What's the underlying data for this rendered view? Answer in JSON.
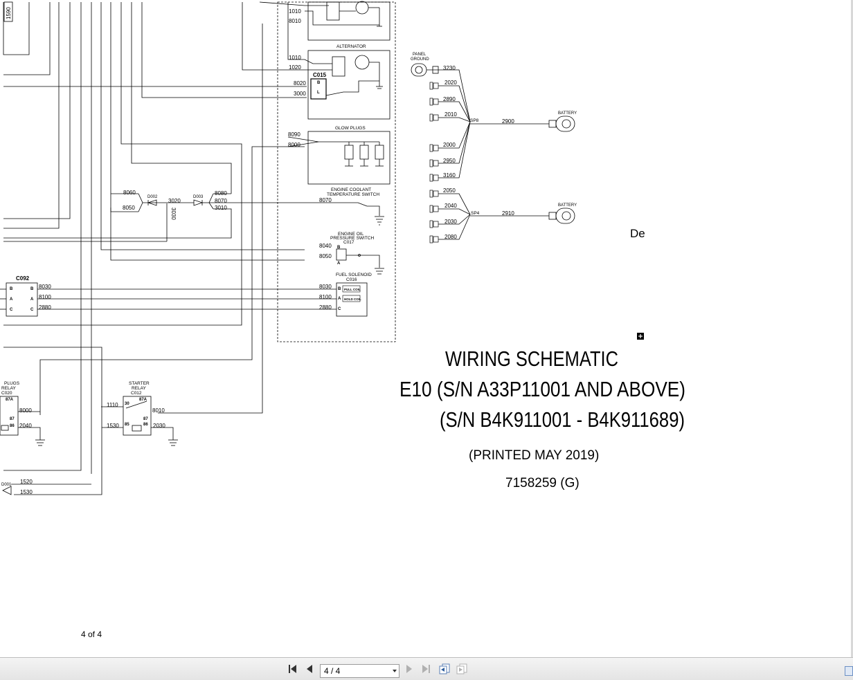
{
  "document": {
    "title_lines": [
      "WIRING SCHEMATIC",
      "E10  (S/N A33P11001 AND ABOVE)",
      "(S/N B4K911001 - B4K911689)"
    ],
    "printed": "(PRINTED MAY 2019)",
    "part_number": "7158259 (G)",
    "page_footer": "4 of 4",
    "partial_text": "De",
    "components": {
      "alternator": "ALTERNATOR",
      "c015": "C015",
      "glow_plugs": "GLOW PLUGS",
      "coolant_switch_1": "ENGINE COOLANT",
      "coolant_switch_2": "TEMPERATURE SWITCH",
      "oil_switch_1": "ENGINE OIL",
      "oil_switch_2": "PRESSURE SWITCH",
      "oil_switch_3": "C017",
      "fuel_solenoid_1": "FUEL SOLENOID",
      "fuel_solenoid_2": "C016",
      "c092": "C092",
      "panel_ground_1": "PANEL",
      "panel_ground_2": "GROUND",
      "battery": "BATTERY",
      "sp8": "SP8",
      "sp4": "SP4",
      "d002": "D002",
      "d003": "D003",
      "d001": "D001",
      "starter_relay_1": "STARTER",
      "starter_relay_2": "RELAY",
      "starter_relay_3": "C012",
      "glow_relay_1": "PLUGS",
      "glow_relay_2": "RELAY",
      "glow_relay_3": "C020",
      "pull_coil": "PULL COIL",
      "hold_coil": "HOLD COIL"
    },
    "wires": {
      "w1010a": "1010",
      "w8010a": "8010",
      "w1010b": "1010",
      "w1020": "1020",
      "w8020": "8020",
      "w3000": "3000",
      "w8090": "8090",
      "w8000a": "8000",
      "w8060": "8060",
      "w8050a": "8050",
      "w3020": "3020",
      "w3030": "3030",
      "w8080": "8080",
      "w8070a": "8070",
      "w3010": "3010",
      "w8070b": "8070",
      "w8040": "8040",
      "w8050b": "8050",
      "w8030a": "8030",
      "w8100a": "8100",
      "w2880a": "2880",
      "w8030b": "8030",
      "w8100b": "8100",
      "w2880b": "2880",
      "w3230": "3230",
      "w2020": "2020",
      "w2890": "2890",
      "w2010": "2010",
      "w2900": "2900",
      "w2000": "2000",
      "w2950": "2950",
      "w3160": "3160",
      "w2050": "2050",
      "w2040a": "2040",
      "w2030a": "2030",
      "w2080": "2080",
      "w2910": "2910",
      "w1110": "1110",
      "w8010b": "8010",
      "w1530a": "1530",
      "w2030b": "2030",
      "w8000b": "8000",
      "w2040b": "2040",
      "w1520": "1520",
      "w1530b": "1530",
      "w1590": "1590"
    },
    "pins": {
      "b": "B",
      "a": "A",
      "c": "C",
      "l": "L",
      "p30": "30",
      "p87a": "87A",
      "p87": "87",
      "p86": "86",
      "p85": "85"
    }
  },
  "toolbar": {
    "page_indicator": "4 / 4",
    "first_icon": "first-page-icon",
    "prev_icon": "previous-page-icon",
    "next_icon": "next-page-icon",
    "last_icon": "last-page-icon",
    "back_view_icon": "previous-view-icon",
    "forward_view_icon": "next-view-icon"
  }
}
